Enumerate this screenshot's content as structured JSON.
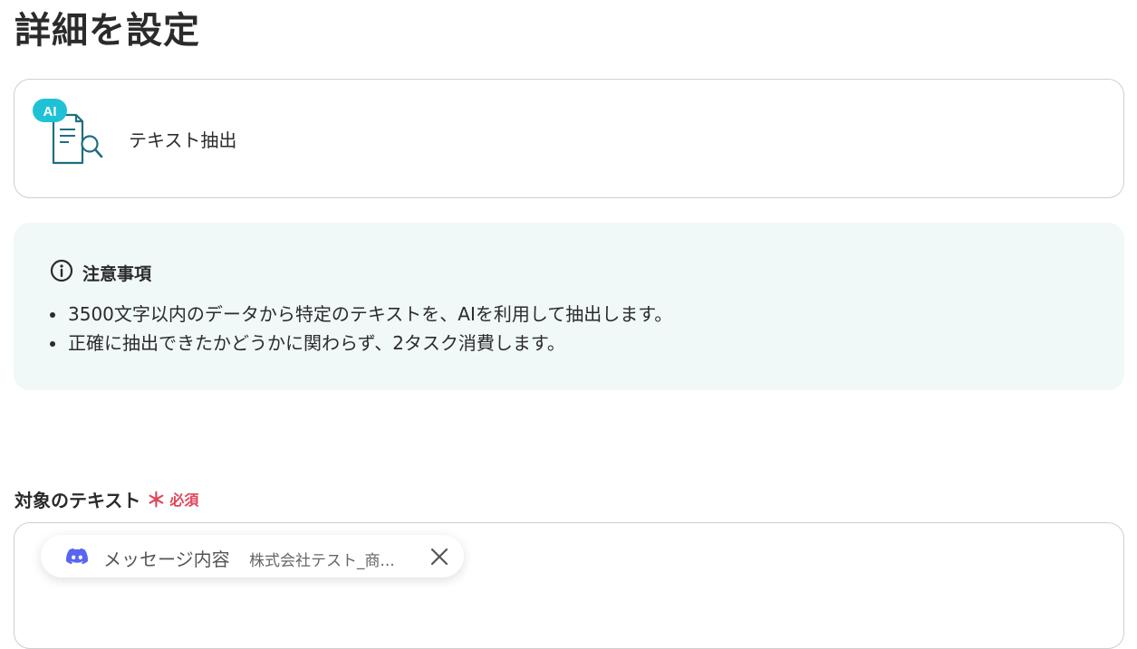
{
  "page": {
    "title": "詳細を設定"
  },
  "action": {
    "badge": "AI",
    "name": "テキスト抽出",
    "icon": "document-search-icon"
  },
  "notice": {
    "title": "注意事項",
    "icon": "info-icon",
    "items": [
      "3500文字以内のデータから特定のテキストを、AIを利用して抽出します。",
      "正確に抽出できたかどうかに関わらず、2タスク消費します。"
    ]
  },
  "field": {
    "label": "対象のテキスト",
    "required_mark": "＊",
    "required_text": "必須"
  },
  "chip": {
    "icon": "discord-icon",
    "name": "メッセージ内容",
    "value": "株式会社テスト_商...",
    "close_icon": "close-icon"
  },
  "colors": {
    "accent_teal": "#1f7a8c",
    "badge_cyan": "#1fc1d6",
    "required_red": "#e0455a",
    "discord": "#5865f2",
    "notice_bg": "#f1f8f8"
  }
}
